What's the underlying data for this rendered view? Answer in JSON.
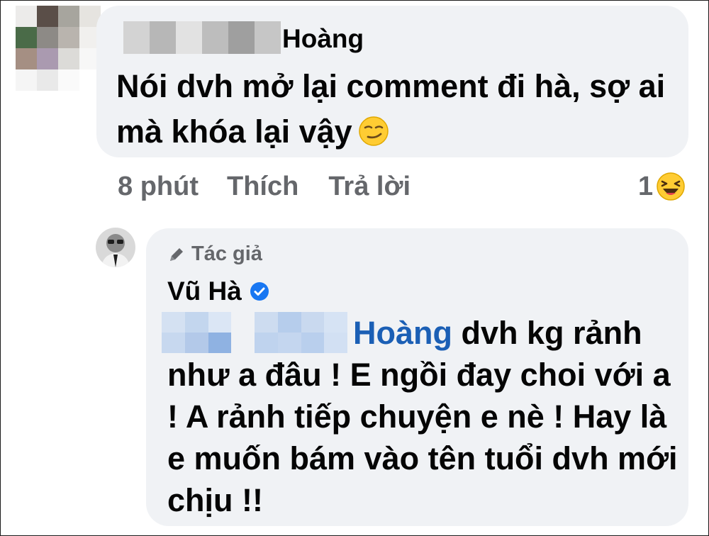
{
  "comment": {
    "author_name_visible": "Hoàng",
    "text": "Nói dvh mở lại comment đi hà, sợ ai mà khóa lại vậy",
    "emoji": "smirk-emoji",
    "time": "8 phút",
    "like_label": "Thích",
    "reply_label": "Trả lời",
    "reaction_count": "1",
    "reaction_emoji": "laughing-emoji"
  },
  "reply": {
    "badge": "Tác giả",
    "author_name": "Vũ Hà",
    "verified_icon": "verified-check-icon",
    "mention": "Hoàng",
    "text": "dvh kg rảnh như a đâu ! E ngồi đay choi với a ! A rảnh tiếp chuyện e nè ! Hay là e muốn bám vào tên tuổi dvh mới chịu !!"
  },
  "colors": {
    "bubble": "#f0f2f5",
    "text": "#050505",
    "meta": "#65676b",
    "mention": "#1b5fb5",
    "verified": "#1877f2"
  }
}
